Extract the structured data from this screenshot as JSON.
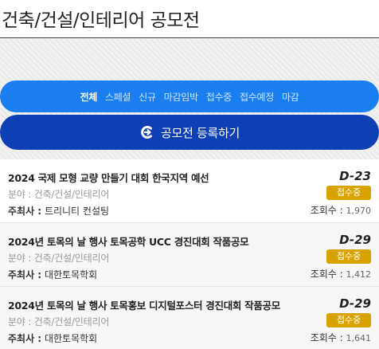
{
  "header": {
    "title": "건축/건설/인테리어 공모전"
  },
  "filters": [
    {
      "label": "전체",
      "active": true
    },
    {
      "label": "스페셜",
      "active": false
    },
    {
      "label": "신규",
      "active": false
    },
    {
      "label": "마감임박",
      "active": false
    },
    {
      "label": "접수중",
      "active": false
    },
    {
      "label": "접수예정",
      "active": false
    },
    {
      "label": "마감",
      "active": false
    }
  ],
  "register": {
    "label": "공모전 등록하기",
    "icon": "arrow-c-icon"
  },
  "labels": {
    "host": "주최사 :",
    "views": "조회수 :"
  },
  "contests": [
    {
      "title": "2024 국제 모형 교량 만들기 대회 한국지역 예선",
      "field": "분야 : 건축/건설/인테리어",
      "host": "트리니티 컨설팅",
      "dday": "D-23",
      "status": "접수중",
      "views": "1,970"
    },
    {
      "title": "2024년 토목의 날 행사 토목공학 UCC 경진대회 작품공모",
      "field": "분야 : 건축/건설/인테리어",
      "host": "대한토목학회",
      "dday": "D-29",
      "status": "접수중",
      "views": "1,412"
    },
    {
      "title": "2024년 토목의 날 행사 토목홍보 디지털포스터 경진대회 작품공모",
      "field": "분야 : 건축/건설/인테리어",
      "host": "대한토목학회",
      "dday": "D-29",
      "status": "접수중",
      "views": "1,641"
    }
  ],
  "colors": {
    "filter_bar": "#1a7df0",
    "register_button": "#0f3fb5",
    "status_badge": "#d8a300"
  }
}
